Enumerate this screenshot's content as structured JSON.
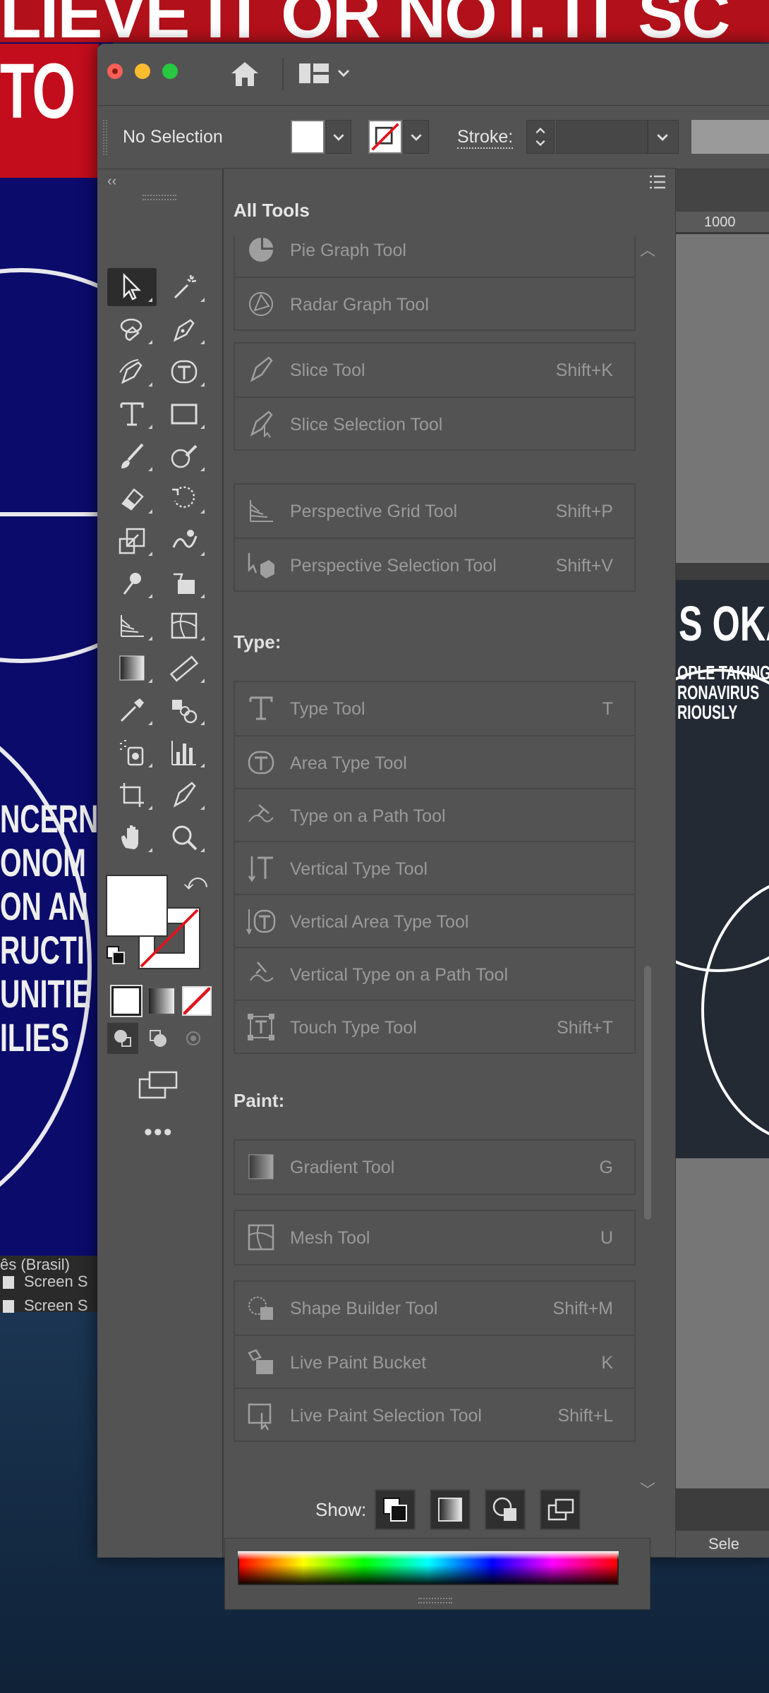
{
  "background": {
    "headline_1": "LIEVE IT OR NOT. IT SC",
    "headline_2": "TO",
    "poster_words": [
      "NCERN",
      "ONOM",
      "ON AN",
      "RUCTI",
      "UNITIE",
      "ILIES"
    ],
    "desktop_label": "ês (Brasil)",
    "desktop_files": [
      "Screen S",
      "Screen S"
    ]
  },
  "control_bar": {
    "selection": "No Selection",
    "stroke_label": "Stroke:"
  },
  "toolbar": {
    "collapse": "‹‹",
    "more": "•••"
  },
  "panel": {
    "title": "All Tools",
    "groups": [
      {
        "rows": [
          {
            "label": "Pie Graph Tool",
            "shortcut": "",
            "icon": "pie-graph-icon"
          },
          {
            "label": "Radar Graph Tool",
            "shortcut": "",
            "icon": "radar-graph-icon"
          }
        ]
      },
      {
        "rows": [
          {
            "label": "Slice Tool",
            "shortcut": "Shift+K",
            "icon": "slice-icon"
          },
          {
            "label": "Slice Selection Tool",
            "shortcut": "",
            "icon": "slice-selection-icon"
          }
        ]
      },
      {
        "rows": [
          {
            "label": "Perspective Grid Tool",
            "shortcut": "Shift+P",
            "icon": "perspective-grid-icon"
          },
          {
            "label": "Perspective Selection Tool",
            "shortcut": "Shift+V",
            "icon": "perspective-selection-icon"
          }
        ]
      }
    ],
    "type_heading": "Type:",
    "type_rows": [
      {
        "label": "Type Tool",
        "shortcut": "T",
        "icon": "type-icon"
      },
      {
        "label": "Area Type Tool",
        "shortcut": "",
        "icon": "area-type-icon"
      },
      {
        "label": "Type on a Path Tool",
        "shortcut": "",
        "icon": "type-on-path-icon"
      },
      {
        "label": "Vertical Type Tool",
        "shortcut": "",
        "icon": "vertical-type-icon"
      },
      {
        "label": "Vertical Area Type Tool",
        "shortcut": "",
        "icon": "vertical-area-type-icon"
      },
      {
        "label": "Vertical Type on a Path Tool",
        "shortcut": "",
        "icon": "vertical-type-on-path-icon"
      },
      {
        "label": "Touch Type Tool",
        "shortcut": "Shift+T",
        "icon": "touch-type-icon"
      }
    ],
    "paint_heading": "Paint:",
    "paint_groups": [
      {
        "rows": [
          {
            "label": "Gradient Tool",
            "shortcut": "G",
            "icon": "gradient-icon"
          }
        ]
      },
      {
        "rows": [
          {
            "label": "Mesh Tool",
            "shortcut": "U",
            "icon": "mesh-icon"
          }
        ]
      },
      {
        "rows": [
          {
            "label": "Shape Builder Tool",
            "shortcut": "Shift+M",
            "icon": "shape-builder-icon"
          },
          {
            "label": "Live Paint Bucket",
            "shortcut": "K",
            "icon": "live-paint-bucket-icon"
          },
          {
            "label": "Live Paint Selection Tool",
            "shortcut": "Shift+L",
            "icon": "live-paint-selection-icon"
          }
        ]
      }
    ],
    "show_label": "Show:"
  },
  "document": {
    "ruler_value": "1000",
    "art_heading": "S OKAY",
    "art_lines": [
      "OPLE TAKING",
      "RONAVIRUS",
      "RIOUSLY"
    ],
    "status": "Sele"
  },
  "colors": {
    "panel_bg": "#535353",
    "close": "#ff5f57",
    "minimize": "#febc2e",
    "maximize": "#28c840",
    "poster_blue": "#0b0b6b",
    "poster_red": "#c30d1c"
  }
}
